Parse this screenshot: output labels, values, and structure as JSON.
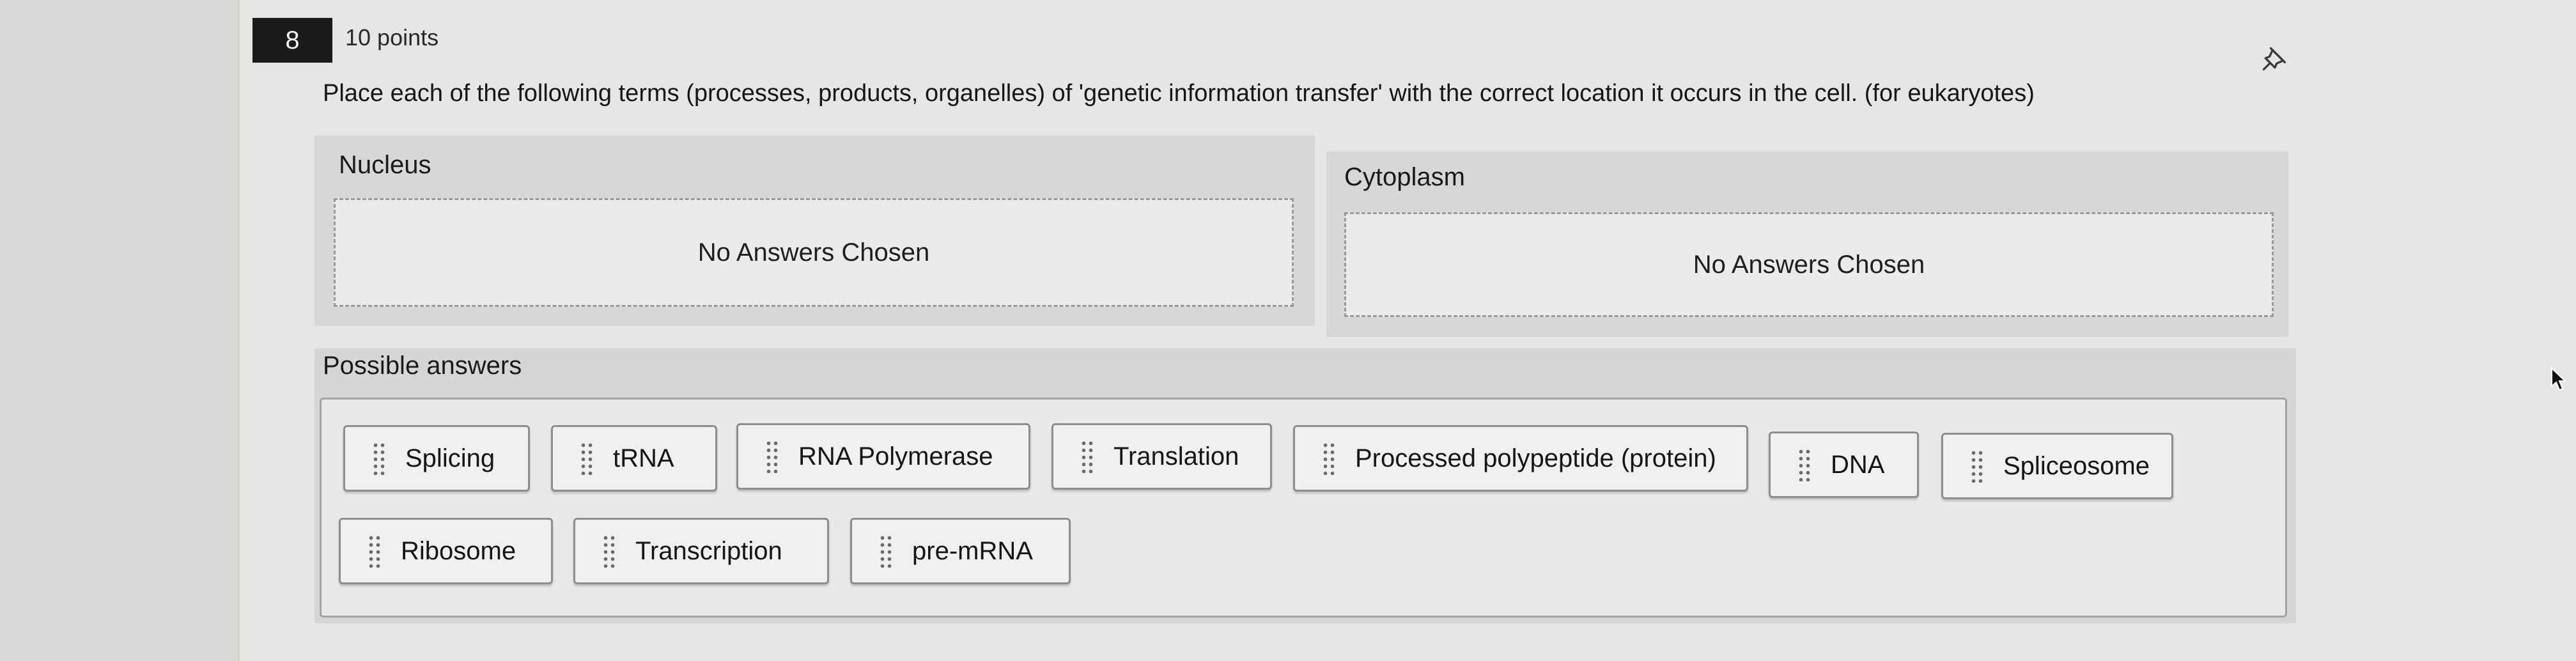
{
  "question": {
    "number": "8",
    "points": "10 points",
    "prompt": "Place each of the following terms (processes, products, organelles) of 'genetic information transfer' with the correct location it occurs in the cell. (for eukaryotes)"
  },
  "icons": {
    "pin": "pin-icon",
    "drag": "drag-handle-icon",
    "cursor": "mouse-pointer-icon"
  },
  "zones": [
    {
      "label": "Nucleus",
      "placeholder": "No Answers Chosen"
    },
    {
      "label": "Cytoplasm",
      "placeholder": "No Answers Chosen"
    }
  ],
  "possible_answers": {
    "title": "Possible answers",
    "items": [
      "Splicing",
      "tRNA",
      "RNA Polymerase",
      "Translation",
      "Processed polypeptide (protein)",
      "DNA",
      "Spliceosome",
      "Ribosome",
      "Transcription",
      "pre-mRNA"
    ]
  }
}
